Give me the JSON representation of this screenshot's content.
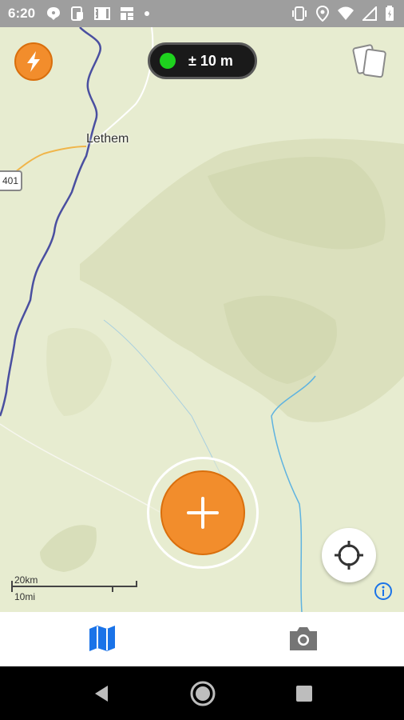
{
  "status_bar": {
    "time": "6:20",
    "left_icons": [
      "chat-bubble-icon",
      "phone-tablet-icon",
      "film-icon",
      "news-icon",
      "dot-icon"
    ],
    "right_icons": [
      "vibrate-icon",
      "location-pin-icon",
      "wifi-icon",
      "signal-icon",
      "battery-icon"
    ]
  },
  "map": {
    "town_label": "Lethem",
    "road_badge": "401",
    "scale": {
      "km_label": "20km",
      "mi_label": "10mi"
    }
  },
  "gps": {
    "accuracy_text": "± 10 m",
    "status_color": "#1ed21e"
  },
  "colors": {
    "accent": "#f28d2c",
    "accent_dark": "#d96f0d",
    "nav_active": "#1a73e8",
    "nav_inactive": "#757575",
    "info": "#1a73e8"
  },
  "toolbar": {
    "quick_action_icon": "lightning-bolt-icon",
    "layers_icon": "cards-icon",
    "add_icon": "plus-icon",
    "locate_icon": "crosshair-icon",
    "info_icon": "info-icon"
  },
  "bottom_nav": {
    "items": [
      {
        "icon": "map-icon",
        "active": true
      },
      {
        "icon": "camera-icon",
        "active": false
      }
    ]
  },
  "system_nav": [
    "back-icon",
    "home-icon",
    "recents-icon"
  ]
}
